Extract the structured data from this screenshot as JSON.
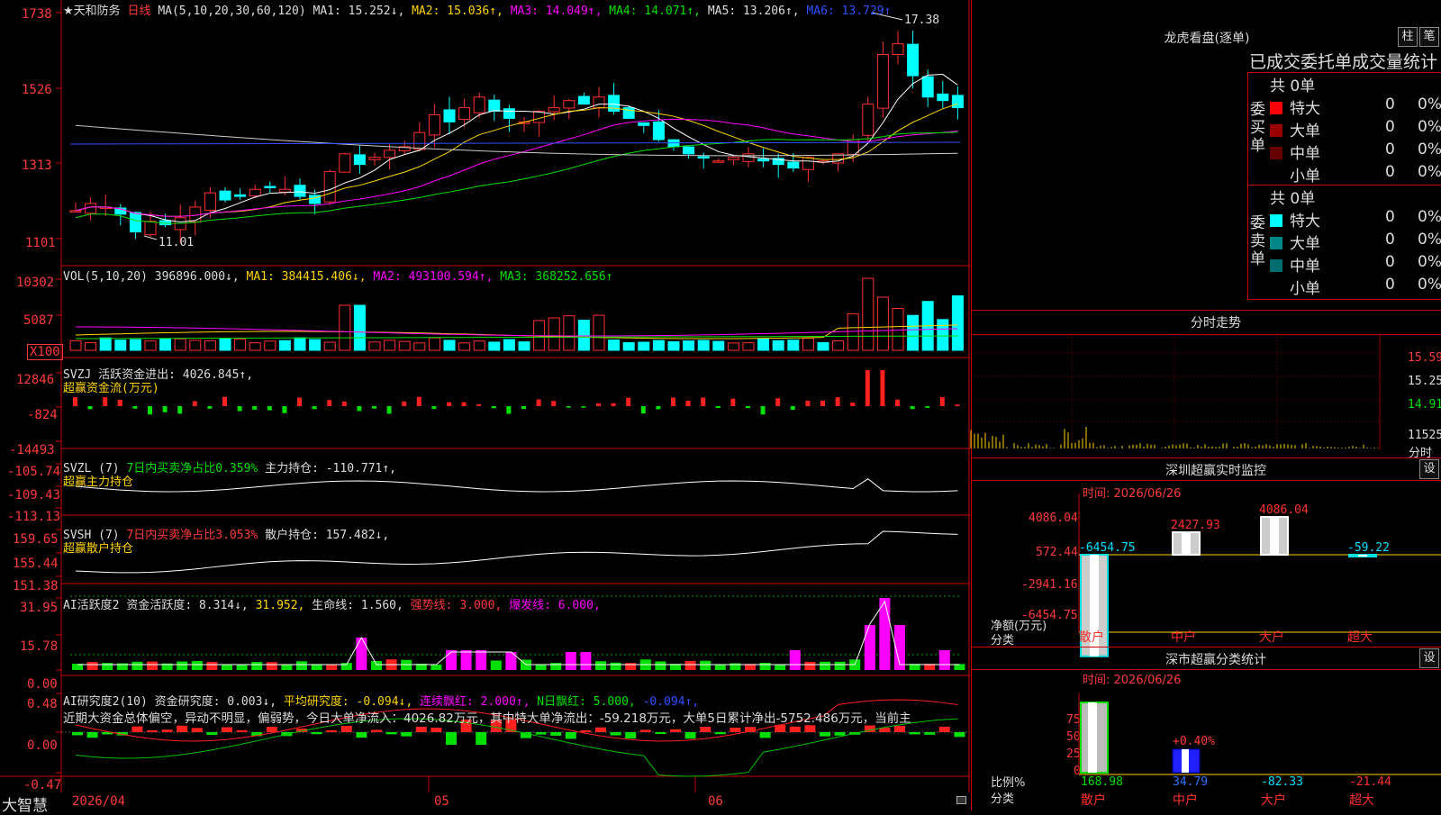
{
  "app": {
    "brand": "大智慧"
  },
  "main_chart": {
    "stock_name": "★天和防务",
    "period": "日线",
    "ma_label": "MA(5,10,20,30,60,120)",
    "ma1": "MA1: 15.252↓,",
    "ma2": "MA2: 15.036↑,",
    "ma3": "MA3: 14.049↑,",
    "ma4": "MA4: 14.071↑,",
    "ma5": "MA5: 13.206↑,",
    "ma6": "MA6: 13.729↑",
    "high_marker": "17.38",
    "low_marker": "11.01",
    "y_ticks": [
      "1738",
      "1526",
      "1313",
      "1101"
    ]
  },
  "vol_panel": {
    "label": "VOL(5,10,20)",
    "value": "396896.000↓,",
    "ma1": "MA1: 384415.406↓,",
    "ma2": "MA2: 493100.594↑,",
    "ma3": "MA3: 368252.656↑",
    "y_ticks": [
      "10302",
      "5087"
    ],
    "unit": "X100"
  },
  "svzj_panel": {
    "label": "SVZJ",
    "value": "活跃资金进出: 4026.845↑,",
    "subtitle": "超赢资金流(万元)",
    "y_ticks": [
      "12846",
      "-824",
      "-14493"
    ]
  },
  "svzl_panel": {
    "label": "SVZL (7)",
    "ratio": "7日内买卖净占比0.359%",
    "value": "主力持仓: -110.771↑,",
    "subtitle": "超赢主力持仓",
    "y_ticks": [
      "-105.74",
      "-109.43",
      "-113.13"
    ]
  },
  "svsh_panel": {
    "label": "SVSH (7)",
    "ratio": "7日内买卖净占比3.053%",
    "value": "散户持仓: 157.482↓,",
    "subtitle": "超赢散户持仓",
    "y_ticks": [
      "159.65",
      "155.44",
      "151.38"
    ]
  },
  "ai_active_panel": {
    "label": "AI活跃度2",
    "value": "资金活跃度: 8.314↓,",
    "value2": "31.952,",
    "life_line": "生命线: 1.560,",
    "strong_line": "强势线: 3.000,",
    "burst_line": "爆发线: 6.000,",
    "y_ticks": [
      "31.95",
      "15.78",
      "0.00"
    ]
  },
  "ai_research_panel": {
    "label": "AI研究度2(10)",
    "value": "资金研究度: 0.003↓,",
    "avg": "平均研究度: -0.094↓,",
    "red_streak": "连续飘红: 2.000↑,",
    "n_red": "N日飘红: 5.000,",
    "last": "-0.094↑,",
    "commentary": "近期大资金总体偏空，异动不明显，偏弱势，今日大单净流入：4026.82万元，其中特大单净流出：-59.218万元，大单5日累计净出-5752.486万元，当前主",
    "y_ticks": [
      "0.48",
      "0.00",
      "-0.47"
    ]
  },
  "x_axis": {
    "labels": [
      "2026/04",
      "05",
      "06"
    ]
  },
  "dragon_tiger": {
    "title": "龙虎看盘(逐单)",
    "btn_bar": "柱",
    "btn_list": "笔",
    "header": "已成交委托单成交量统计",
    "buy_label": "委买单",
    "sell_label": "委卖单",
    "buy_total": "共 0单",
    "sell_total": "共 0单",
    "buy_rows": [
      {
        "name": "特大",
        "count": "0",
        "pct": "0%",
        "color": "#ff0000"
      },
      {
        "name": "大单",
        "count": "0",
        "pct": "0%",
        "color": "#990000"
      },
      {
        "name": "中单",
        "count": "0",
        "pct": "0%",
        "color": "#660000"
      },
      {
        "name": "小单",
        "count": "0",
        "pct": "0%",
        "color": "#000000"
      }
    ],
    "sell_rows": [
      {
        "name": "特大",
        "count": "0",
        "pct": "0%",
        "color": "#00ffff"
      },
      {
        "name": "大单",
        "count": "0",
        "pct": "0%",
        "color": "#008888"
      },
      {
        "name": "中单",
        "count": "0",
        "pct": "0%",
        "color": "#006e6e"
      },
      {
        "name": "小单",
        "count": "0",
        "pct": "0%",
        "color": "#000000"
      }
    ]
  },
  "intraday": {
    "title": "分时走势",
    "price_ticks": [
      "15.59",
      "15.25",
      "14.91"
    ],
    "vol_tick": "11525",
    "footer": "分时"
  },
  "sz_monitor": {
    "title": "深圳超赢实时监控",
    "settings": "设",
    "time": "时间: 2026/06/26",
    "y_ticks": [
      "4086.04",
      "572.44",
      "-2941.16",
      "-6454.75"
    ],
    "y_label": "净额(万元)",
    "x_label": "分类",
    "categories": [
      "散户",
      "中户",
      "大户",
      "超大"
    ],
    "values": [
      -6454.75,
      2427.93,
      4086.04,
      -59.22
    ],
    "value_labels": [
      "-6454.75",
      "2427.93",
      "4086.04",
      "-59.22"
    ]
  },
  "sz_class": {
    "title": "深市超赢分类统计",
    "settings": "设",
    "time": "时间: 2026/06/26",
    "y_ticks": [
      "75",
      "50",
      "25",
      "0"
    ],
    "y_label": "比例%",
    "x_label": "分类",
    "categories": [
      "散户",
      "中户",
      "大户",
      "超大"
    ],
    "value_labels": [
      "168.98",
      "34.79",
      "-82.33",
      "-21.44"
    ],
    "bar_tag": "+0.40%"
  }
}
